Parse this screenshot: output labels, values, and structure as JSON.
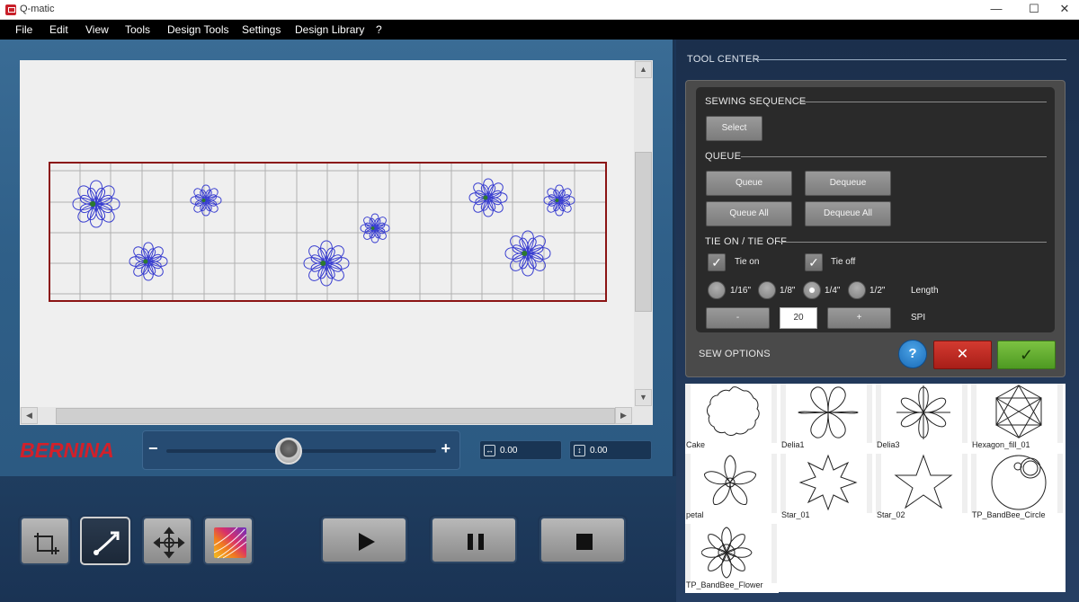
{
  "window": {
    "title": "Q-matic",
    "controls": {
      "minimize": "—",
      "maximize": "☐",
      "close": "✕"
    }
  },
  "menu": [
    "File",
    "Edit",
    "View",
    "Tools",
    "Design Tools",
    "Settings",
    "Design Library",
    "?"
  ],
  "brand": "BERNINA",
  "zoom": {
    "minus": "−",
    "plus": "+",
    "level_fraction": 0.5
  },
  "dimensions": {
    "width": "0.00",
    "height": "0.00"
  },
  "tools": [
    "crop-tool",
    "path-tool",
    "move-tool",
    "color-tool"
  ],
  "tool_center": {
    "label": "TOOL CENTER",
    "sewing_sequence": {
      "label": "SEWING SEQUENCE",
      "select": "Select"
    },
    "queue": {
      "label": "QUEUE",
      "queue": "Queue",
      "dequeue": "Dequeue",
      "queue_all": "Queue All",
      "dequeue_all": "Dequeue All"
    },
    "tie": {
      "label": "TIE ON / TIE OFF",
      "tie_on": "Tie on",
      "tie_off": "Tie off",
      "tie_on_checked": true,
      "tie_off_checked": true,
      "lengths": [
        "1/16\"",
        "1/8\"",
        "1/4\"",
        "1/2\""
      ],
      "selected_length": "1/4\"",
      "length_label": "Length",
      "minus": "-",
      "plus": "+",
      "spi": "20",
      "spi_label": "SPI"
    },
    "sew_options": {
      "label": "SEW OPTIONS",
      "help": "?",
      "cancel": "✕",
      "ok": "✓"
    }
  },
  "library": [
    {
      "name": "Cake",
      "icon": "cake-icon"
    },
    {
      "name": "Delia1",
      "icon": "delia1-icon"
    },
    {
      "name": "Delia3",
      "icon": "delia3-icon"
    },
    {
      "name": "Hexagon_fill_01",
      "icon": "hexagon-fill-icon"
    },
    {
      "name": "petal",
      "icon": "petal-icon"
    },
    {
      "name": "Star_01",
      "icon": "star8-icon"
    },
    {
      "name": "Star_02",
      "icon": "star5-icon"
    },
    {
      "name": "TP_BandBee_Circle",
      "icon": "bandbee-circle-icon"
    },
    {
      "name": "TP_BandBee_Flower",
      "icon": "bandbee-flower-icon"
    }
  ],
  "colors": {
    "accent_red": "#d2202a",
    "stitch_blue": "#3a3fd0",
    "frame_red": "#8b1414"
  }
}
